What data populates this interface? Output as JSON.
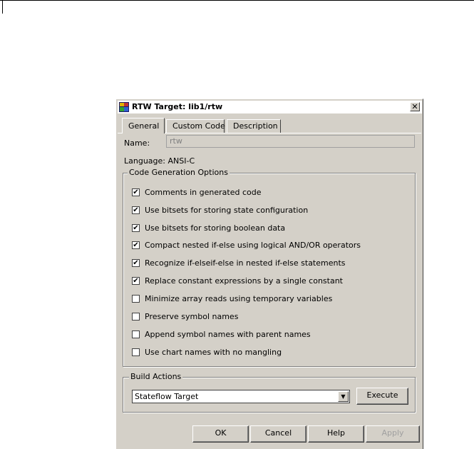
{
  "window": {
    "title": "RTW Target: lib1/rtw",
    "close_glyph": "✕"
  },
  "tabs": [
    {
      "label": "General",
      "active": true
    },
    {
      "label": "Custom Code",
      "active": false
    },
    {
      "label": "Description",
      "active": false
    }
  ],
  "general": {
    "name_label": "Name:",
    "name_value": "rtw",
    "language_text": "Language:  ANSI-C"
  },
  "code_generation": {
    "title": "Code Generation Options",
    "options": [
      {
        "label": "Comments in generated code",
        "checked": true
      },
      {
        "label": "Use bitsets for storing state configuration",
        "checked": true
      },
      {
        "label": "Use bitsets for storing boolean data",
        "checked": true
      },
      {
        "label": "Compact nested if-else using logical AND/OR operators",
        "checked": true
      },
      {
        "label": "Recognize if-elseif-else in nested if-else statements",
        "checked": true
      },
      {
        "label": "Replace constant expressions by a single constant",
        "checked": true
      },
      {
        "label": "Minimize array reads using temporary variables",
        "checked": false
      },
      {
        "label": "Preserve symbol names",
        "checked": false
      },
      {
        "label": "Append symbol names with parent names",
        "checked": false
      },
      {
        "label": "Use chart names with no mangling",
        "checked": false
      }
    ]
  },
  "build_actions": {
    "title": "Build Actions",
    "selected": "Stateflow Target",
    "execute_label": "Execute"
  },
  "buttons": {
    "ok": "OK",
    "cancel": "Cancel",
    "help": "Help",
    "apply": "Apply"
  },
  "icons": {
    "title_icon": "stateflow-chart-icon",
    "dropdown_icon": "chevron-down-icon",
    "check_glyph": "✔"
  }
}
